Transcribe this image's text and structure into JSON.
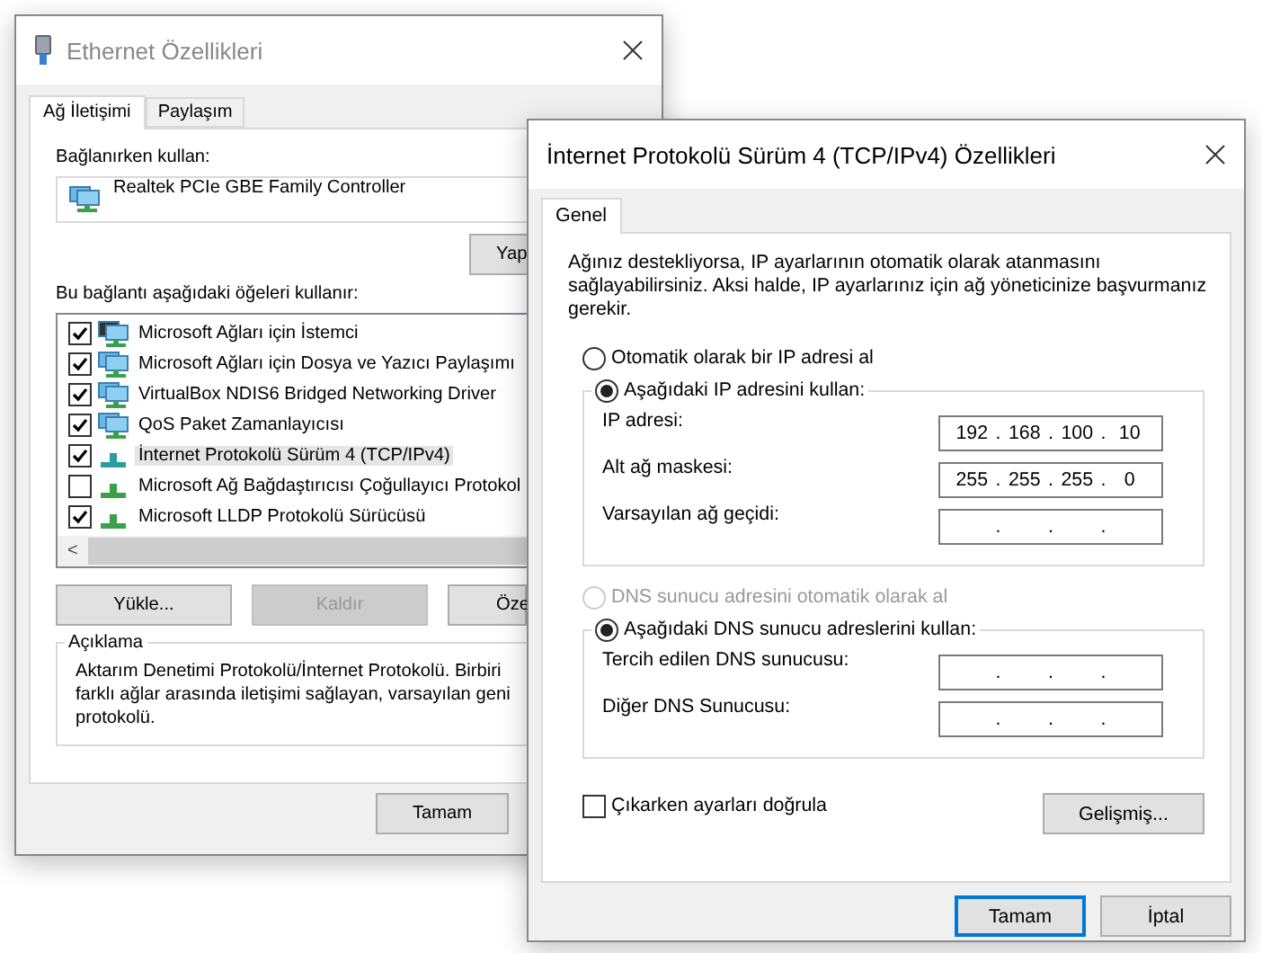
{
  "back_window": {
    "title": "Ethernet Özellikleri",
    "active": false,
    "tabs": [
      {
        "label": "Ağ İletişimi",
        "selected": true
      },
      {
        "label": "Paylaşım",
        "selected": false
      }
    ],
    "connect_using_label": "Bağlanırken kullan:",
    "adapter": "Realtek PCIe GBE Family Controller",
    "configure_button": "Yap",
    "items_label": "Bu bağlantı aşağıdaki öğeleri kullanır:",
    "items": [
      {
        "label": "Microsoft Ağları için İstemci",
        "checked": true,
        "selected": false,
        "kind": "client"
      },
      {
        "label": "Microsoft Ağları için Dosya ve Yazıcı Paylaşımı",
        "checked": true,
        "selected": false,
        "kind": "service"
      },
      {
        "label": "VirtualBox NDIS6 Bridged Networking Driver",
        "checked": true,
        "selected": false,
        "kind": "service"
      },
      {
        "label": "QoS Paket Zamanlayıcısı",
        "checked": true,
        "selected": false,
        "kind": "service"
      },
      {
        "label": "İnternet Protokolü Sürüm 4 (TCP/IPv4)",
        "checked": true,
        "selected": true,
        "kind": "protocol"
      },
      {
        "label": "Microsoft Ağ Bağdaştırıcısı Çoğullayıcı Protokol",
        "checked": false,
        "selected": false,
        "kind": "protocol"
      },
      {
        "label": "Microsoft LLDP Protokolü Sürücüsü",
        "checked": true,
        "selected": false,
        "kind": "protocol"
      }
    ],
    "scroll_left": "<",
    "buttons": [
      {
        "label": "Yükle...",
        "disabled": false
      },
      {
        "label": "Kaldır",
        "disabled": true
      },
      {
        "label": "Öze",
        "disabled": false
      }
    ],
    "description": {
      "title": "Açıklama",
      "lines": [
        "Aktarım Denetimi Protokolü/İnternet Protokolü. Birbiri",
        "farklı ağlar arasında iletişimi sağlayan, varsayılan geni",
        "protokolü."
      ]
    },
    "footer_buttons": [
      {
        "label": "Tamam",
        "focused": false
      }
    ]
  },
  "front_window": {
    "title": "İnternet Protokolü Sürüm 4 (TCP/IPv4) Özellikleri",
    "active": true,
    "tabs": [
      {
        "label": "Genel",
        "selected": true
      }
    ],
    "intro": "Ağınız destekliyorsa, IP ayarlarının otomatik olarak atanmasını sağlayabilirsiniz. Aksi halde, IP ayarlarınız için ağ yöneticinize başvurmanız gerekir.",
    "separator": ".",
    "ip_options": [
      {
        "label": "Otomatik olarak bir IP adresi al",
        "selected": false,
        "disabled": false
      },
      {
        "label": "Aşağıdaki IP adresini kullan:",
        "selected": true,
        "disabled": false
      }
    ],
    "ip_fields": [
      {
        "label": "IP adresi:",
        "octets": [
          "192",
          "168",
          "100",
          "10"
        ]
      },
      {
        "label": "Alt ağ maskesi:",
        "octets": [
          "255",
          "255",
          "255",
          "0"
        ]
      },
      {
        "label": "Varsayılan ağ geçidi:"
      }
    ],
    "dns_options": [
      {
        "label": "DNS sunucu adresini otomatik olarak al",
        "selected": false,
        "disabled": true
      },
      {
        "label": "Aşağıdaki DNS sunucu adreslerini kullan:",
        "selected": true,
        "disabled": false
      }
    ],
    "dns_fields": [
      {
        "label": "Tercih edilen DNS sunucusu:"
      },
      {
        "label": "Diğer DNS Sunucusu:"
      }
    ],
    "validate": {
      "label": "Çıkarken ayarları doğrula",
      "checked": false
    },
    "advanced_button": "Gelişmiş...",
    "footer_buttons": [
      {
        "label": "Tamam",
        "focused": true
      },
      {
        "label": "İptal",
        "focused": false
      }
    ]
  }
}
